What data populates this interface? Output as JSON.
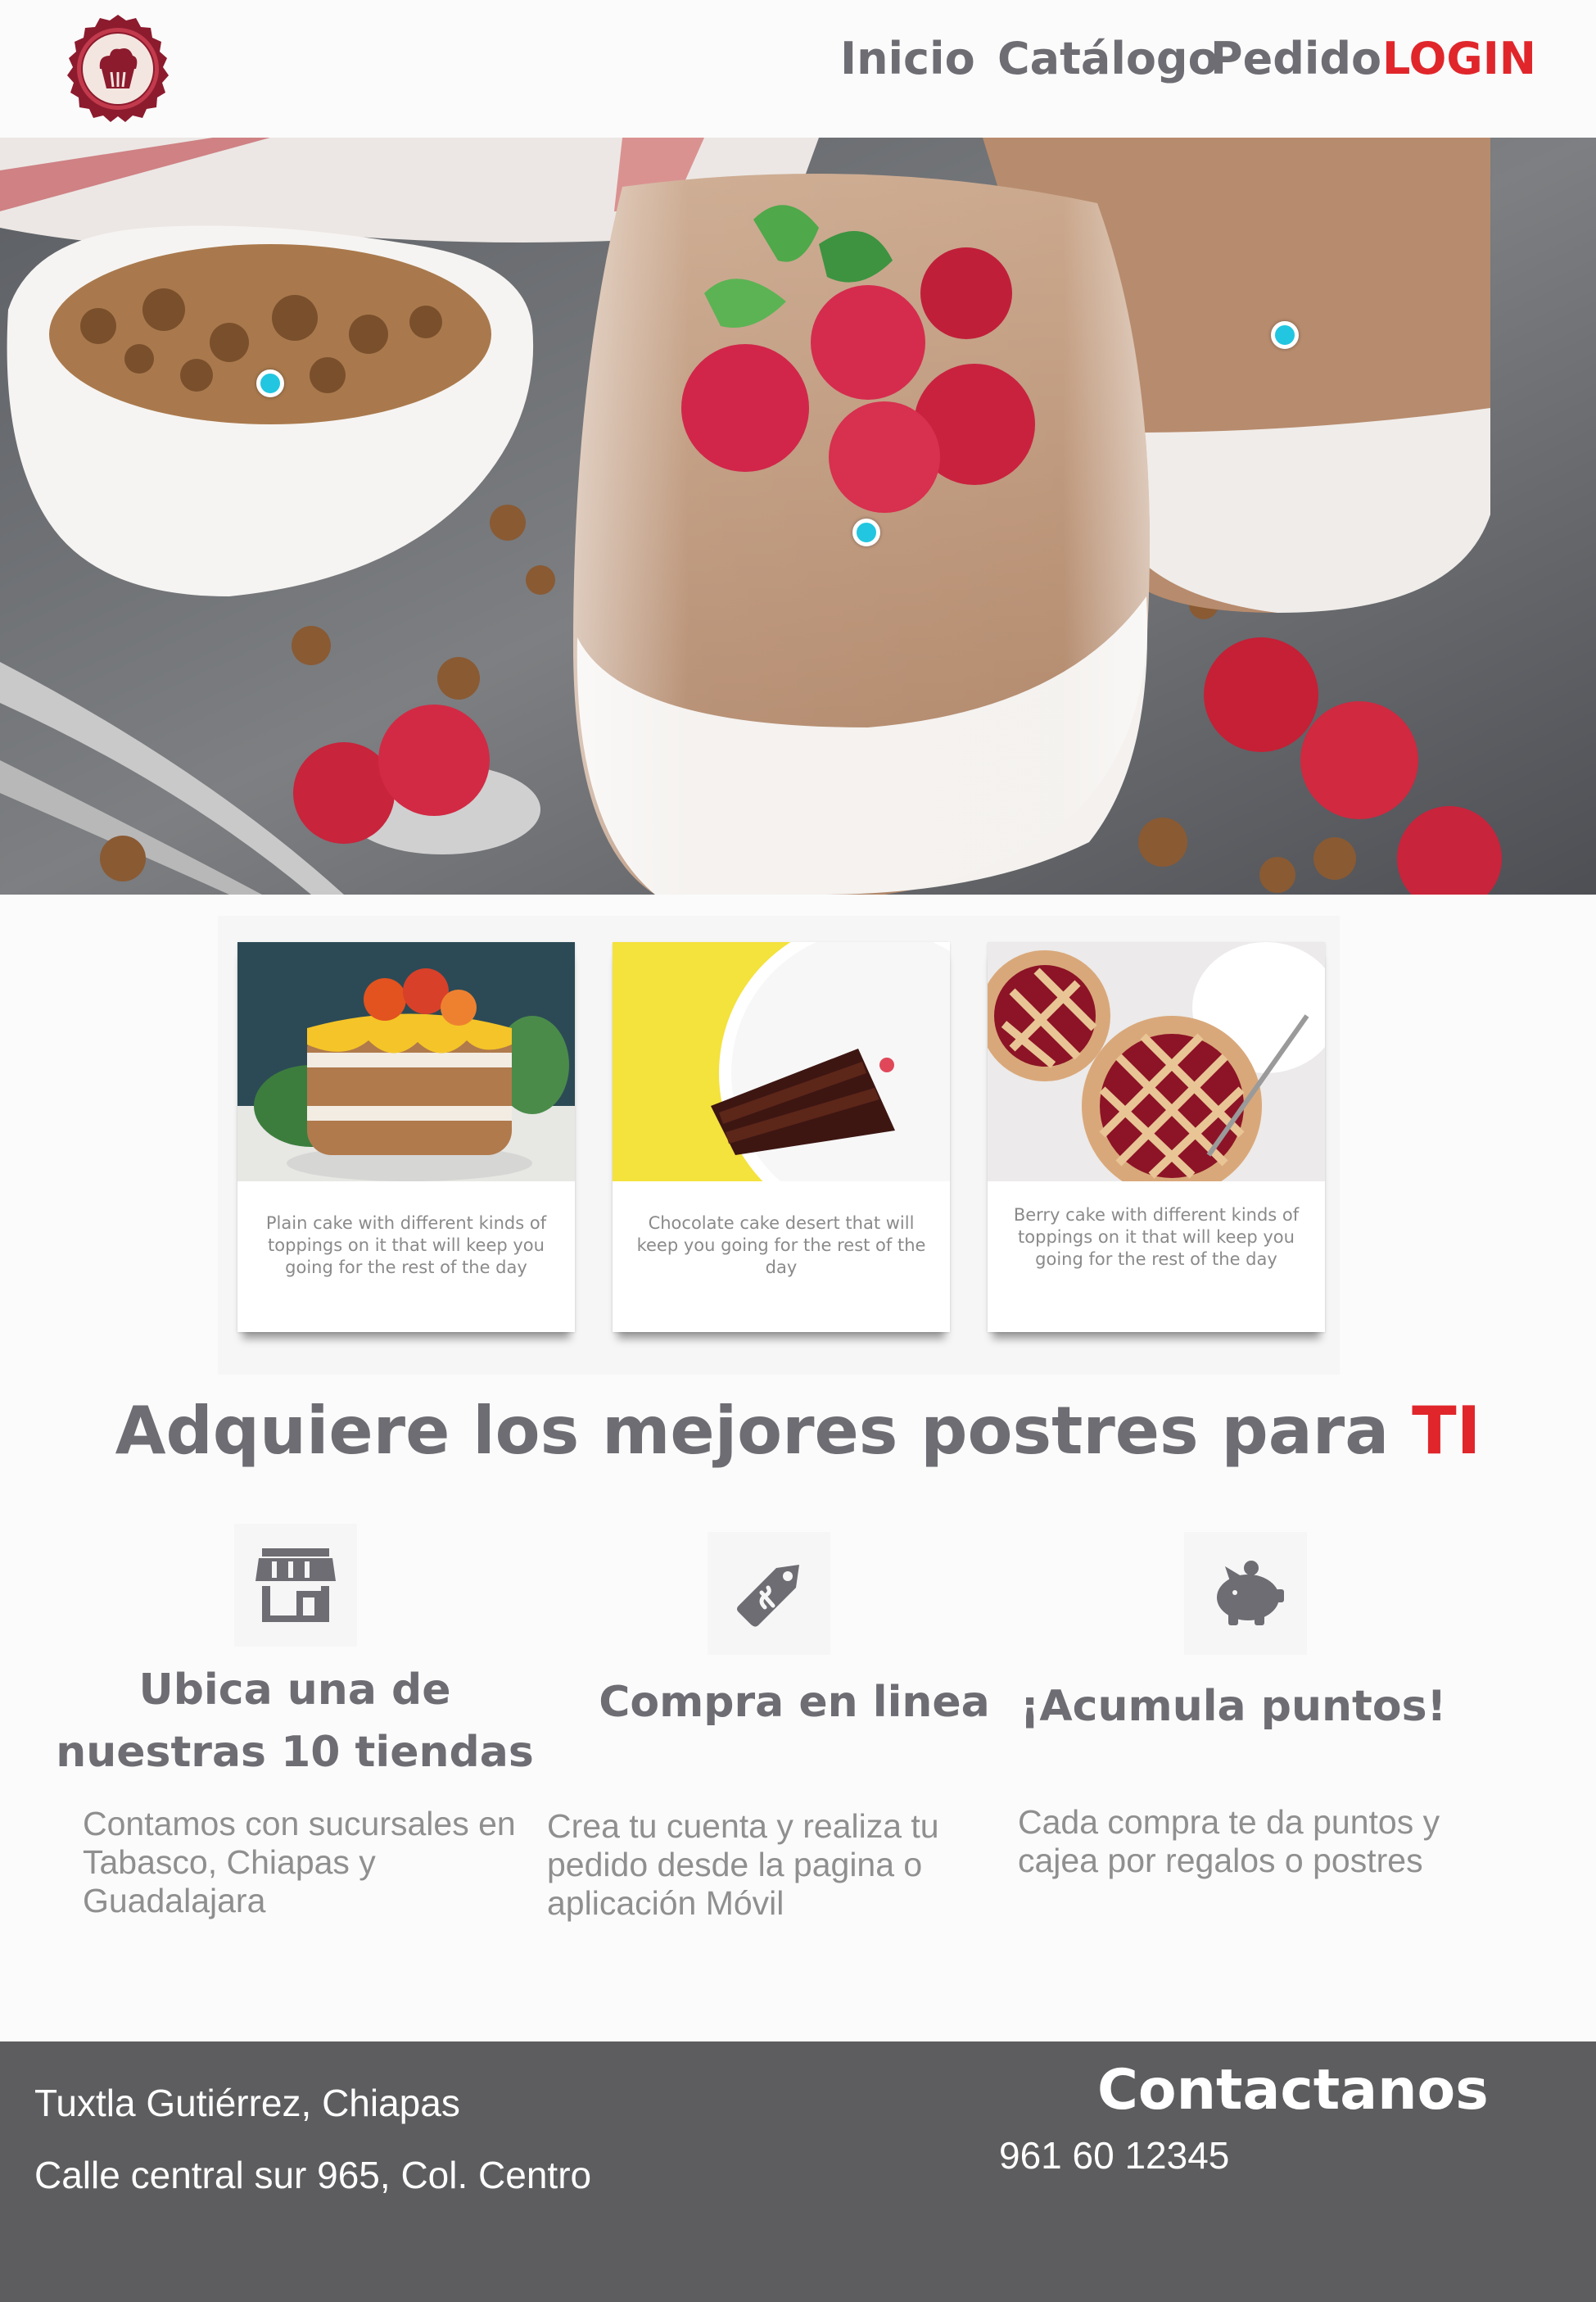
{
  "brand": {
    "logo": "cupcake-logo",
    "colors": {
      "accent": "#e0262b",
      "text": "#6d6d73",
      "footer": "#5d5d5f",
      "hotspot": "#22c6e0"
    }
  },
  "nav": {
    "inicio": "Inicio",
    "catalogo": "Catálogo",
    "pedido": "Pedido",
    "login": "LOGIN"
  },
  "cards": [
    {
      "text": "Plain cake with different kinds of toppings on it that will keep you going for the rest of the day"
    },
    {
      "text": "Chocolate cake desert that will keep you going for the rest of the day"
    },
    {
      "text": "Berry cake with different kinds of toppings on it that will keep you going for the rest of the day"
    }
  ],
  "headline": {
    "main": "Adquiere los mejores postres para",
    "accent": "TI"
  },
  "features": [
    {
      "icon": "store-icon",
      "title_line1": "Ubica una de",
      "title_line2": "nuestras 10 tiendas",
      "text_line1": "Contamos con sucursales en",
      "text_line2": "Tabasco, Chiapas y",
      "text_line3": "Guadalajara"
    },
    {
      "icon": "price-tag-icon",
      "title": "Compra en linea",
      "text_line1": "Crea tu cuenta y realiza tu",
      "text_line2": "pedido desde la pagina o",
      "text_line3": "aplicación Móvil"
    },
    {
      "icon": "piggy-bank-icon",
      "title": "¡Acumula puntos!",
      "text_line1": "Cada compra te da puntos y",
      "text_line2": "cajea por regalos o postres"
    }
  ],
  "footer": {
    "city": "Tuxtla Gutiérrez, Chiapas",
    "address": "Calle central sur 965, Col. Centro",
    "contact_title": "Contactanos",
    "phone": "961 60 12345"
  }
}
